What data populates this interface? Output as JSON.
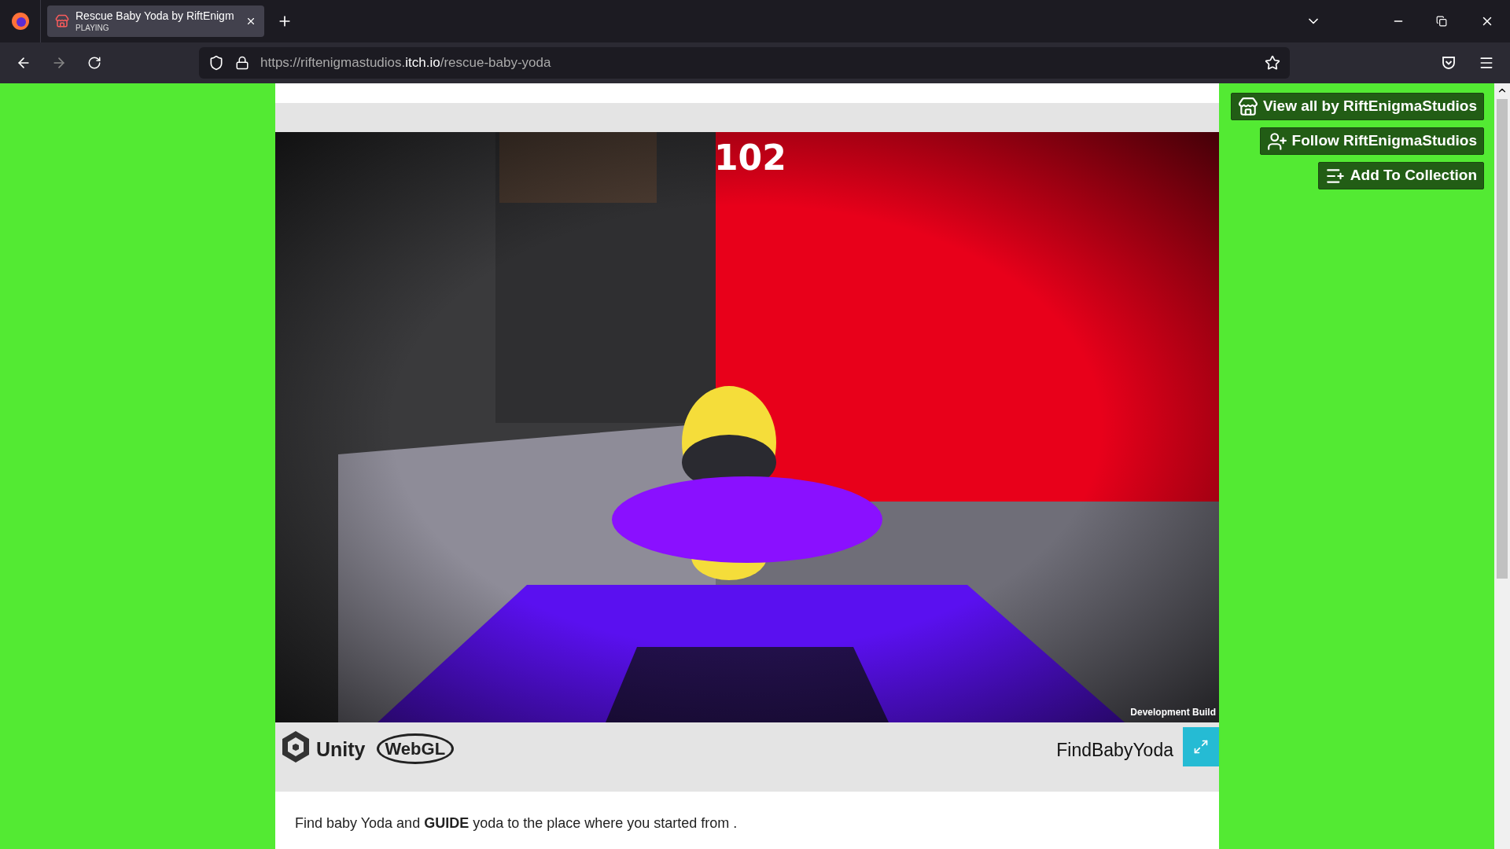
{
  "browser": {
    "tabs": [
      {
        "title": "Rescue Baby Yoda by RiftEnigm",
        "subtitle": "PLAYING",
        "selected": true
      }
    ],
    "url": {
      "prefix": "https://riftenigmastudios.",
      "domain": "itch.io",
      "path": "/rescue-baby-yoda"
    }
  },
  "game": {
    "score": "102",
    "badge": "Development Build"
  },
  "player_bar": {
    "unity": "Unity",
    "webgl": "WebGL",
    "title": "FindBabyYoda"
  },
  "description": "Find baby Yoda and **GUIDE** yoda to the place where you started from .",
  "actions": [
    {
      "kind": "view",
      "label": "View all by RiftEnigmaStudios"
    },
    {
      "kind": "follow",
      "label": "Follow RiftEnigmaStudios"
    },
    {
      "kind": "collection",
      "label": "Add To Collection"
    }
  ]
}
